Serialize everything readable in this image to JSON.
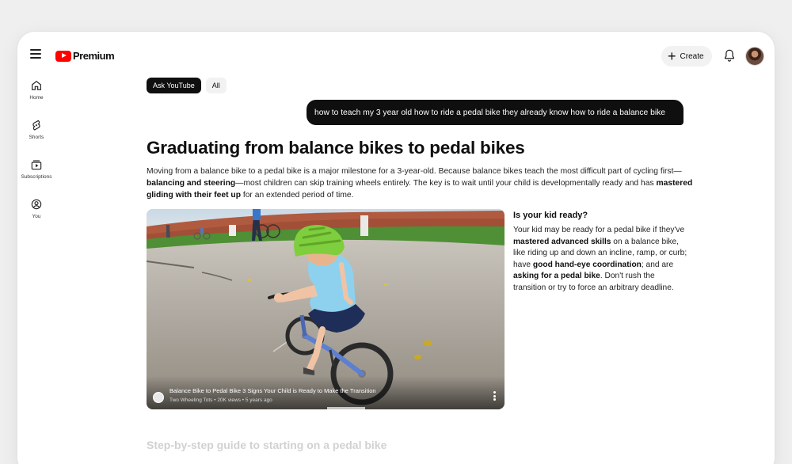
{
  "header": {
    "logo_text": "Premium",
    "create_label": "Create"
  },
  "sidebar": {
    "items": [
      {
        "label": "Home",
        "icon": "home-icon"
      },
      {
        "label": "Shorts",
        "icon": "shorts-icon"
      },
      {
        "label": "Subscriptions",
        "icon": "subscriptions-icon"
      },
      {
        "label": "You",
        "icon": "you-icon"
      }
    ]
  },
  "chips": [
    {
      "label": "Ask YouTube",
      "active": true
    },
    {
      "label": "All",
      "active": false
    }
  ],
  "query": "how to teach my 3 year old how to ride a pedal bike they already know how to ride a balance bike",
  "answer": {
    "title": "Graduating from balance bikes to pedal bikes",
    "intro": {
      "t1": "Moving from a balance bike to a pedal bike is a major milestone for a 3-year-old. Because balance bikes teach the most difficult part of cycling first—",
      "b1": "balancing and steering",
      "t2": "—most children can skip training wheels entirely. The key is to wait until your child is developmentally ready and has ",
      "b2": "mastered gliding with their feet up",
      "t3": " for an extended period of time."
    },
    "side": {
      "heading": "Is your kid ready?",
      "t1": "Your kid may be ready for a pedal bike if they've ",
      "b1": "mastered advanced skills",
      "t2": " on a balance bike, like riding up and down an incline, ramp, or curb; have ",
      "b2": "good hand-eye coordination",
      "t3": "; and are ",
      "b3": "asking for a pedal bike",
      "t4": ". Don't rush the transition or try to force an arbitrary deadline."
    },
    "next_heading": "Step-by-step guide to starting on a pedal bike"
  },
  "video": {
    "title": "Balance Bike to Pedal Bike 3 Signs Your Child is Ready to Make the Transition",
    "meta": "Two Wheeling Tots • 20K views • 5 years ago",
    "progress": 0.1
  },
  "colors": {
    "brand_red": "#ff0000",
    "chip_active": "#0f0f0f",
    "helmet": "#7fce3d",
    "shirt": "#8ed1ee"
  }
}
